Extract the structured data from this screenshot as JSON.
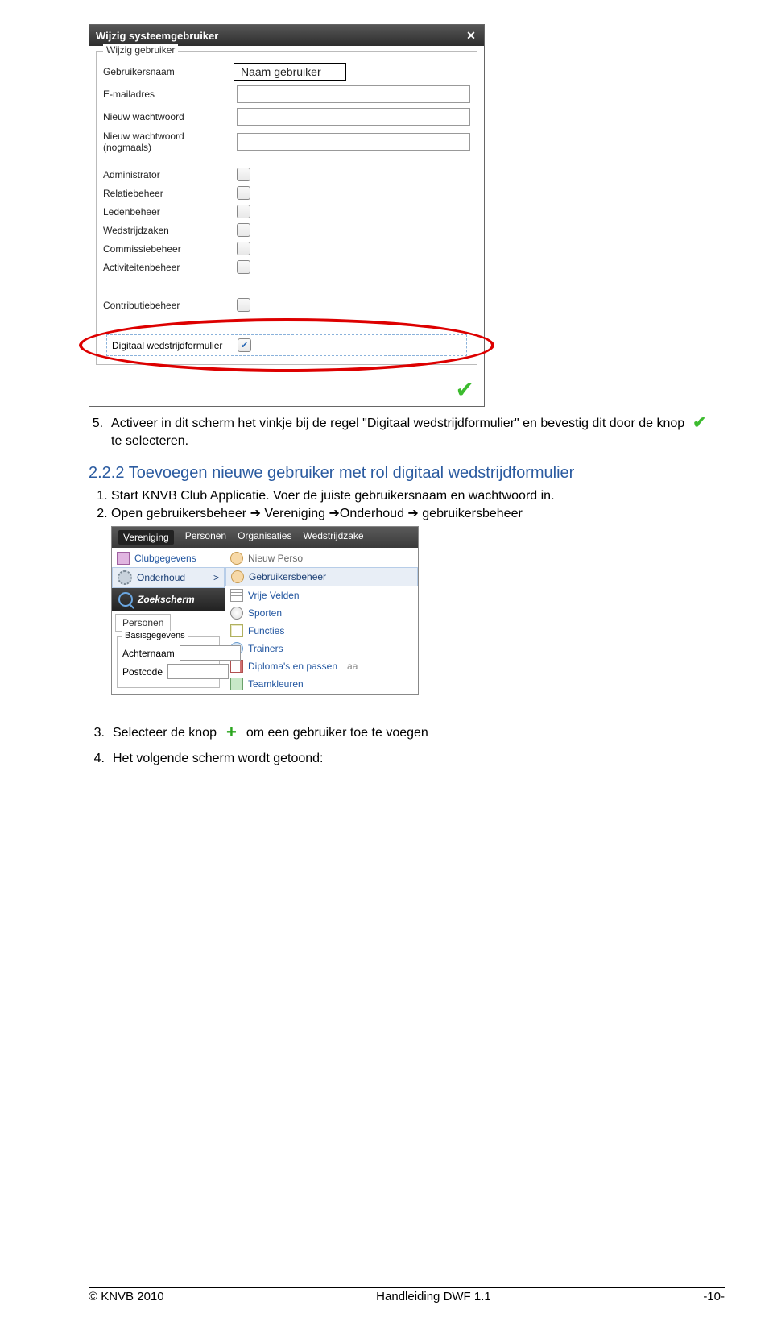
{
  "dialog": {
    "title": "Wijzig systeemgebruiker",
    "legend": "Wijzig gebruiker",
    "rows": {
      "gebruikersnaam": "Gebruikersnaam",
      "email": "E-mailadres",
      "nieuw_ww": "Nieuw wachtwoord",
      "nieuw_ww2": "Nieuw wachtwoord (nogmaals)"
    },
    "naam_overlay": "Naam gebruiker",
    "checks": [
      "Administrator",
      "Relatiebeheer",
      "Ledenbeheer",
      "Wedstrijdzaken",
      "Commissiebeheer",
      "Activiteitenbeheer"
    ],
    "contributie": "Contributiebeheer",
    "highlight_label": "Digitaal wedstrijdformulier"
  },
  "step5": {
    "num": "5.",
    "text_before": "Activeer in dit scherm het vinkje bij de regel \"Digitaal wedstrijdformulier\" en bevestig dit door de knop ",
    "text_after": " te selecteren."
  },
  "heading": {
    "num": "2.2.2",
    "title": "Toevoegen nieuwe gebruiker met rol digitaal wedstrijdformulier"
  },
  "inner_list": {
    "i1": "Start KNVB Club Applicatie. Voer de juiste gebruikersnaam en wachtwoord in.",
    "i2_pre": "Open gebruikersbeheer ",
    "i2_a": "Vereniging",
    "i2_b": "Onderhoud",
    "i2_c": "gebruikersbeheer"
  },
  "menu": {
    "tabs": [
      "Vereniging",
      "Personen",
      "Organisaties",
      "Wedstrijdzake"
    ],
    "left": {
      "clubgegevens": "Clubgegevens",
      "onderhoud": "Onderhoud",
      "chevron": ">"
    },
    "right_top": "Nieuw Perso",
    "submenu": [
      "Gebruikersbeheer",
      "Vrije Velden",
      "Sporten",
      "Functies",
      "Trainers",
      "Diploma's en passen",
      "Teamkleuren"
    ],
    "zoek": "Zoekscherm",
    "personen_tab": "Personen",
    "basis_legend": "Basisgegevens",
    "achternaam": "Achternaam",
    "postcode": "Postcode",
    "extra_col": "aa"
  },
  "step3": {
    "num": "3.",
    "before": "Selecteer de knop ",
    "after": " om een gebruiker toe te voegen"
  },
  "step4": {
    "num": "4.",
    "text": "Het volgende scherm wordt getoond:"
  },
  "footer": {
    "left": "© KNVB 2010",
    "center": "Handleiding DWF 1.1",
    "right": "-10-"
  }
}
